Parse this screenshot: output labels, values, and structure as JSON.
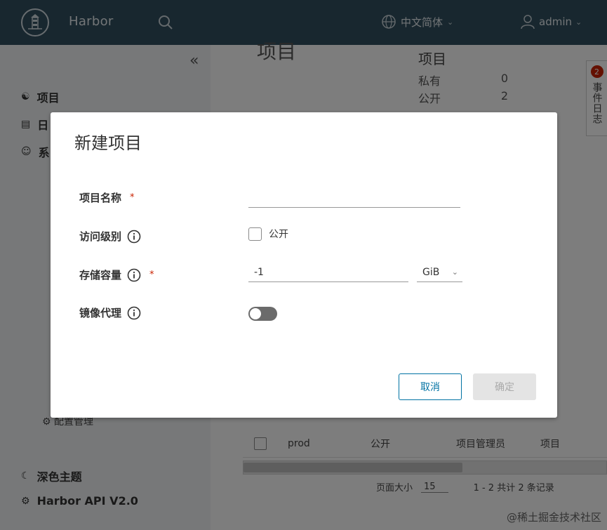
{
  "header": {
    "brand": "Harbor",
    "language": "中文简体",
    "user": "admin"
  },
  "sidebar": {
    "collapse_glyph": "«",
    "items": [
      {
        "label": "项目",
        "icon": "projects-icon"
      },
      {
        "label": "日",
        "icon": "logs-icon"
      },
      {
        "label": "系",
        "icon": "system-icon"
      }
    ],
    "sub_items": [
      {
        "label": "配置管理",
        "icon": "gear-icon"
      }
    ],
    "dark_theme": "深色主题",
    "api_label": "Harbor API V2.0"
  },
  "main": {
    "page_title": "项目",
    "summary": {
      "title": "项目",
      "rows": [
        {
          "label": "私有",
          "value": "0"
        },
        {
          "label": "公开",
          "value": "2"
        }
      ]
    },
    "event_tab": {
      "badge": "2",
      "label": "事件日志"
    },
    "table_row": {
      "name": "prod",
      "access": "公开",
      "role": "项目管理员",
      "type": "项目"
    },
    "pager": {
      "page_size_label": "页面大小",
      "page_size": "15",
      "range": "1 - 2 共计 2 条记录"
    }
  },
  "modal": {
    "title": "新建项目",
    "project_name_label": "项目名称",
    "access_label": "访问级别",
    "access_option": "公开",
    "storage_label": "存储容量",
    "storage_value": "-1",
    "storage_unit": "GiB",
    "proxy_label": "镜像代理",
    "required_mark": "*",
    "cancel_label": "取消",
    "ok_label": "确定"
  },
  "watermark": "@稀土掘金技术社区"
}
